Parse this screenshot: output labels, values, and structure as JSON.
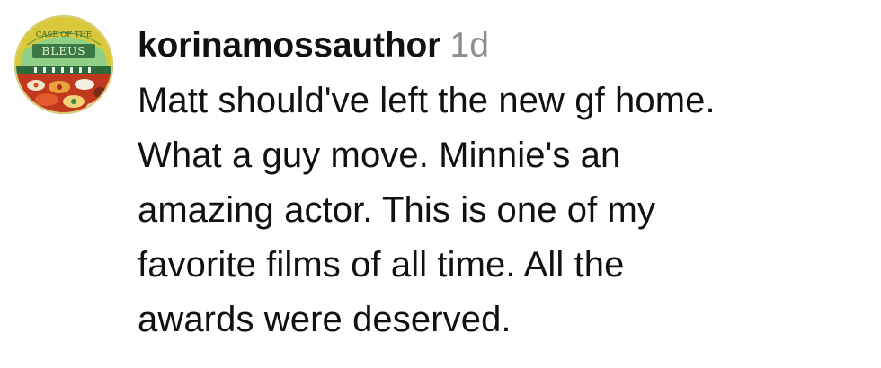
{
  "comment": {
    "username": "korinamossauthor",
    "timestamp": "1d",
    "lines": [
      "Matt should've left the new gf home.",
      "What a guy move. Minnie's an",
      "amazing actor. This is one of my",
      "favorite films of all time. All the",
      "awards were deserved."
    ]
  },
  "avatar": {
    "logo_text_top": "CASE OF THE",
    "logo_text_bottom": "BLEUS",
    "colors": {
      "background": "#e6d63e",
      "sign": "#8fcf88",
      "banner": "#2e6b3a",
      "table": "#c0391f"
    }
  },
  "colors": {
    "text": "#111111",
    "timestamp": "#8e8e8e"
  }
}
